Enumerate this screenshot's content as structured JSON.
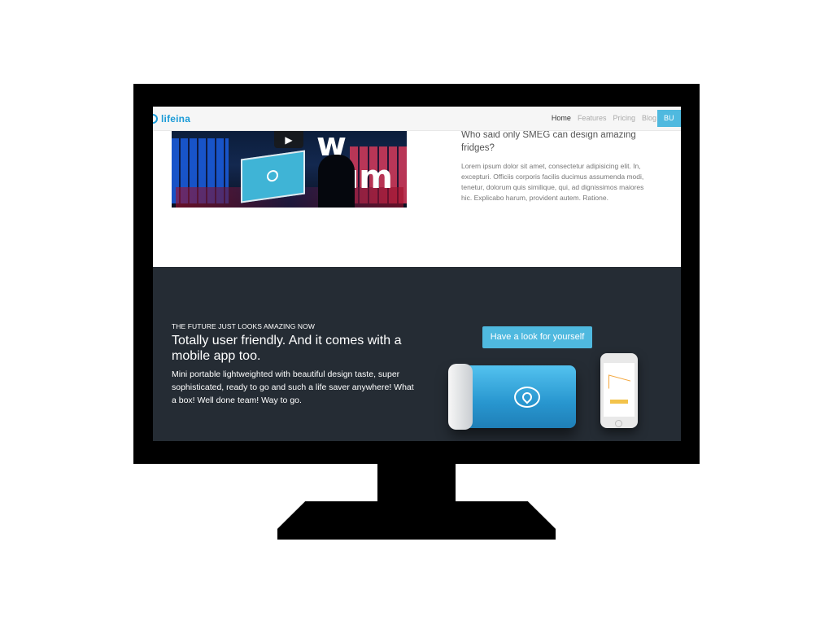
{
  "brand": {
    "name": "lifeina"
  },
  "nav": {
    "items": [
      {
        "label": "Home",
        "active": true
      },
      {
        "label": "Features",
        "active": false
      },
      {
        "label": "Pricing",
        "active": false
      },
      {
        "label": "Blog",
        "active": false
      }
    ],
    "buy_label": "BU"
  },
  "video": {
    "overlay_text": "w sum",
    "play_icon": "play-icon"
  },
  "info": {
    "title": "Who said only SMEG can design amazing fridges?",
    "body": "Lorem ipsum dolor sit amet, consectetur adipisicing elit. In, excepturi. Officiis corporis facilis ducimus assumenda modi, tenetur, dolorum quis similique, qui, ad dignissimos maiores hic. Explicabo harum, provident autem. Ratione."
  },
  "promo": {
    "eyebrow": "THE FUTURE JUST LOOKS AMAZING NOW",
    "headline": "Totally user friendly. And it comes with a mobile app too.",
    "description": "Mini portable lightweighted with beautiful design taste, super sophisticated, ready to go and such a life saver anywhere! What a box! Well done team! Way to go.",
    "cta_label": "Have a look for yourself"
  },
  "colors": {
    "accent": "#4fb9df",
    "brand": "#1a9bd7",
    "dark_section": "#252c34",
    "monitor": "#000000"
  }
}
